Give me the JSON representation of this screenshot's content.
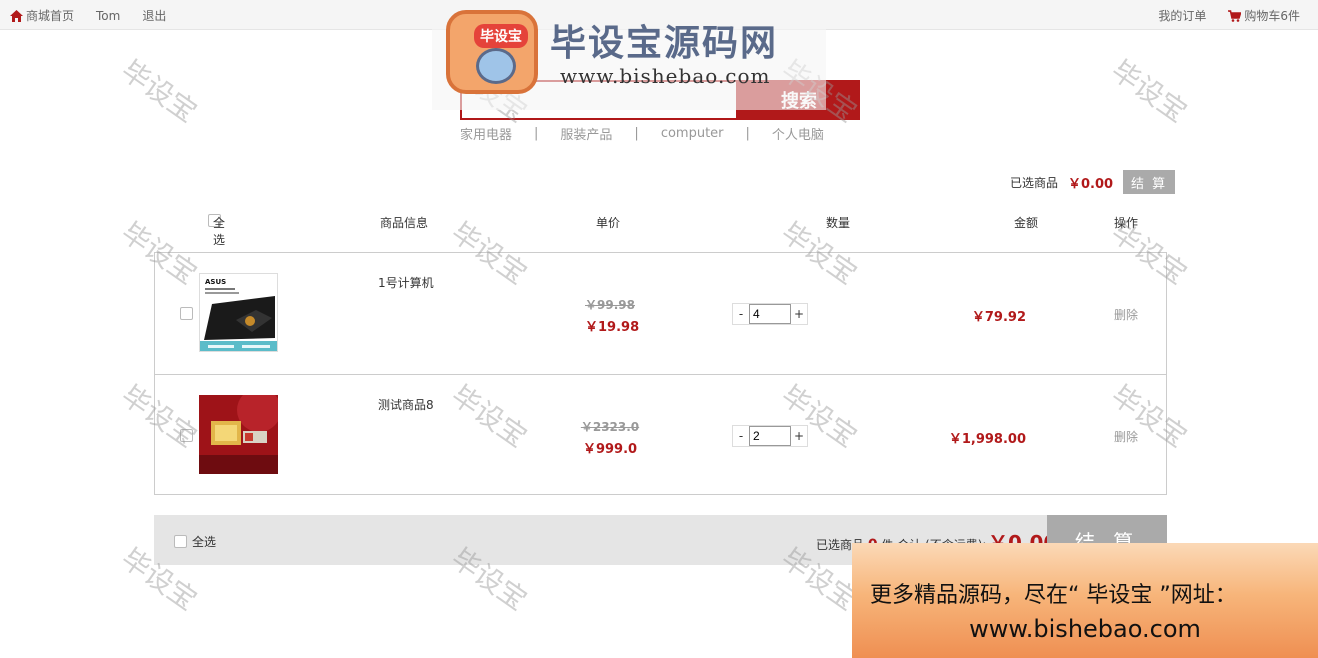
{
  "topbar": {
    "home": "商城首页",
    "user": "Tom",
    "logout": "退出",
    "orders": "我的订单",
    "cart": "购物车6件"
  },
  "logo": {
    "badge": "毕设宝",
    "title": "毕设宝源码网",
    "url": "www.bishebao.com"
  },
  "search": {
    "placeholder": "",
    "button": "搜索"
  },
  "hotwords": [
    "家用电器",
    "服装产品",
    "computer",
    "个人电脑"
  ],
  "hotword_sep": "|",
  "summary_top": {
    "label": "已选商品",
    "amount": "￥0.00",
    "checkout": "结 算"
  },
  "table_header": {
    "select_all": "全选",
    "info": "商品信息",
    "price": "单价",
    "qty": "数量",
    "amount": "金额",
    "action": "操作"
  },
  "items": [
    {
      "name": "1号计算机",
      "old_price": "￥99.98",
      "price": "￥19.98",
      "qty": "4",
      "subtotal": "￥79.92",
      "delete": "删除",
      "minus": "-",
      "plus": "+",
      "thumb_brand": "ASUS"
    },
    {
      "name": "测试商品8",
      "old_price": "￥2323.0",
      "price": "￥999.0",
      "qty": "2",
      "subtotal": "￥1,998.00",
      "delete": "删除",
      "minus": "-",
      "plus": "+"
    }
  ],
  "footer": {
    "select_all": "全选",
    "selected_prefix": "已选商品",
    "selected_count": "0",
    "selected_suffix": "件 合计 (不含运费):",
    "total": "￥0.00",
    "checkout": "结 算"
  },
  "watermark": "毕设宝",
  "promo": {
    "line1": "更多精品源码，尽在“ 毕设宝 ”网址：",
    "line2": "www.bishebao.com"
  },
  "colors": {
    "accent": "#b1191a",
    "muted": "#999999",
    "button_gray": "#aaaaaa"
  }
}
